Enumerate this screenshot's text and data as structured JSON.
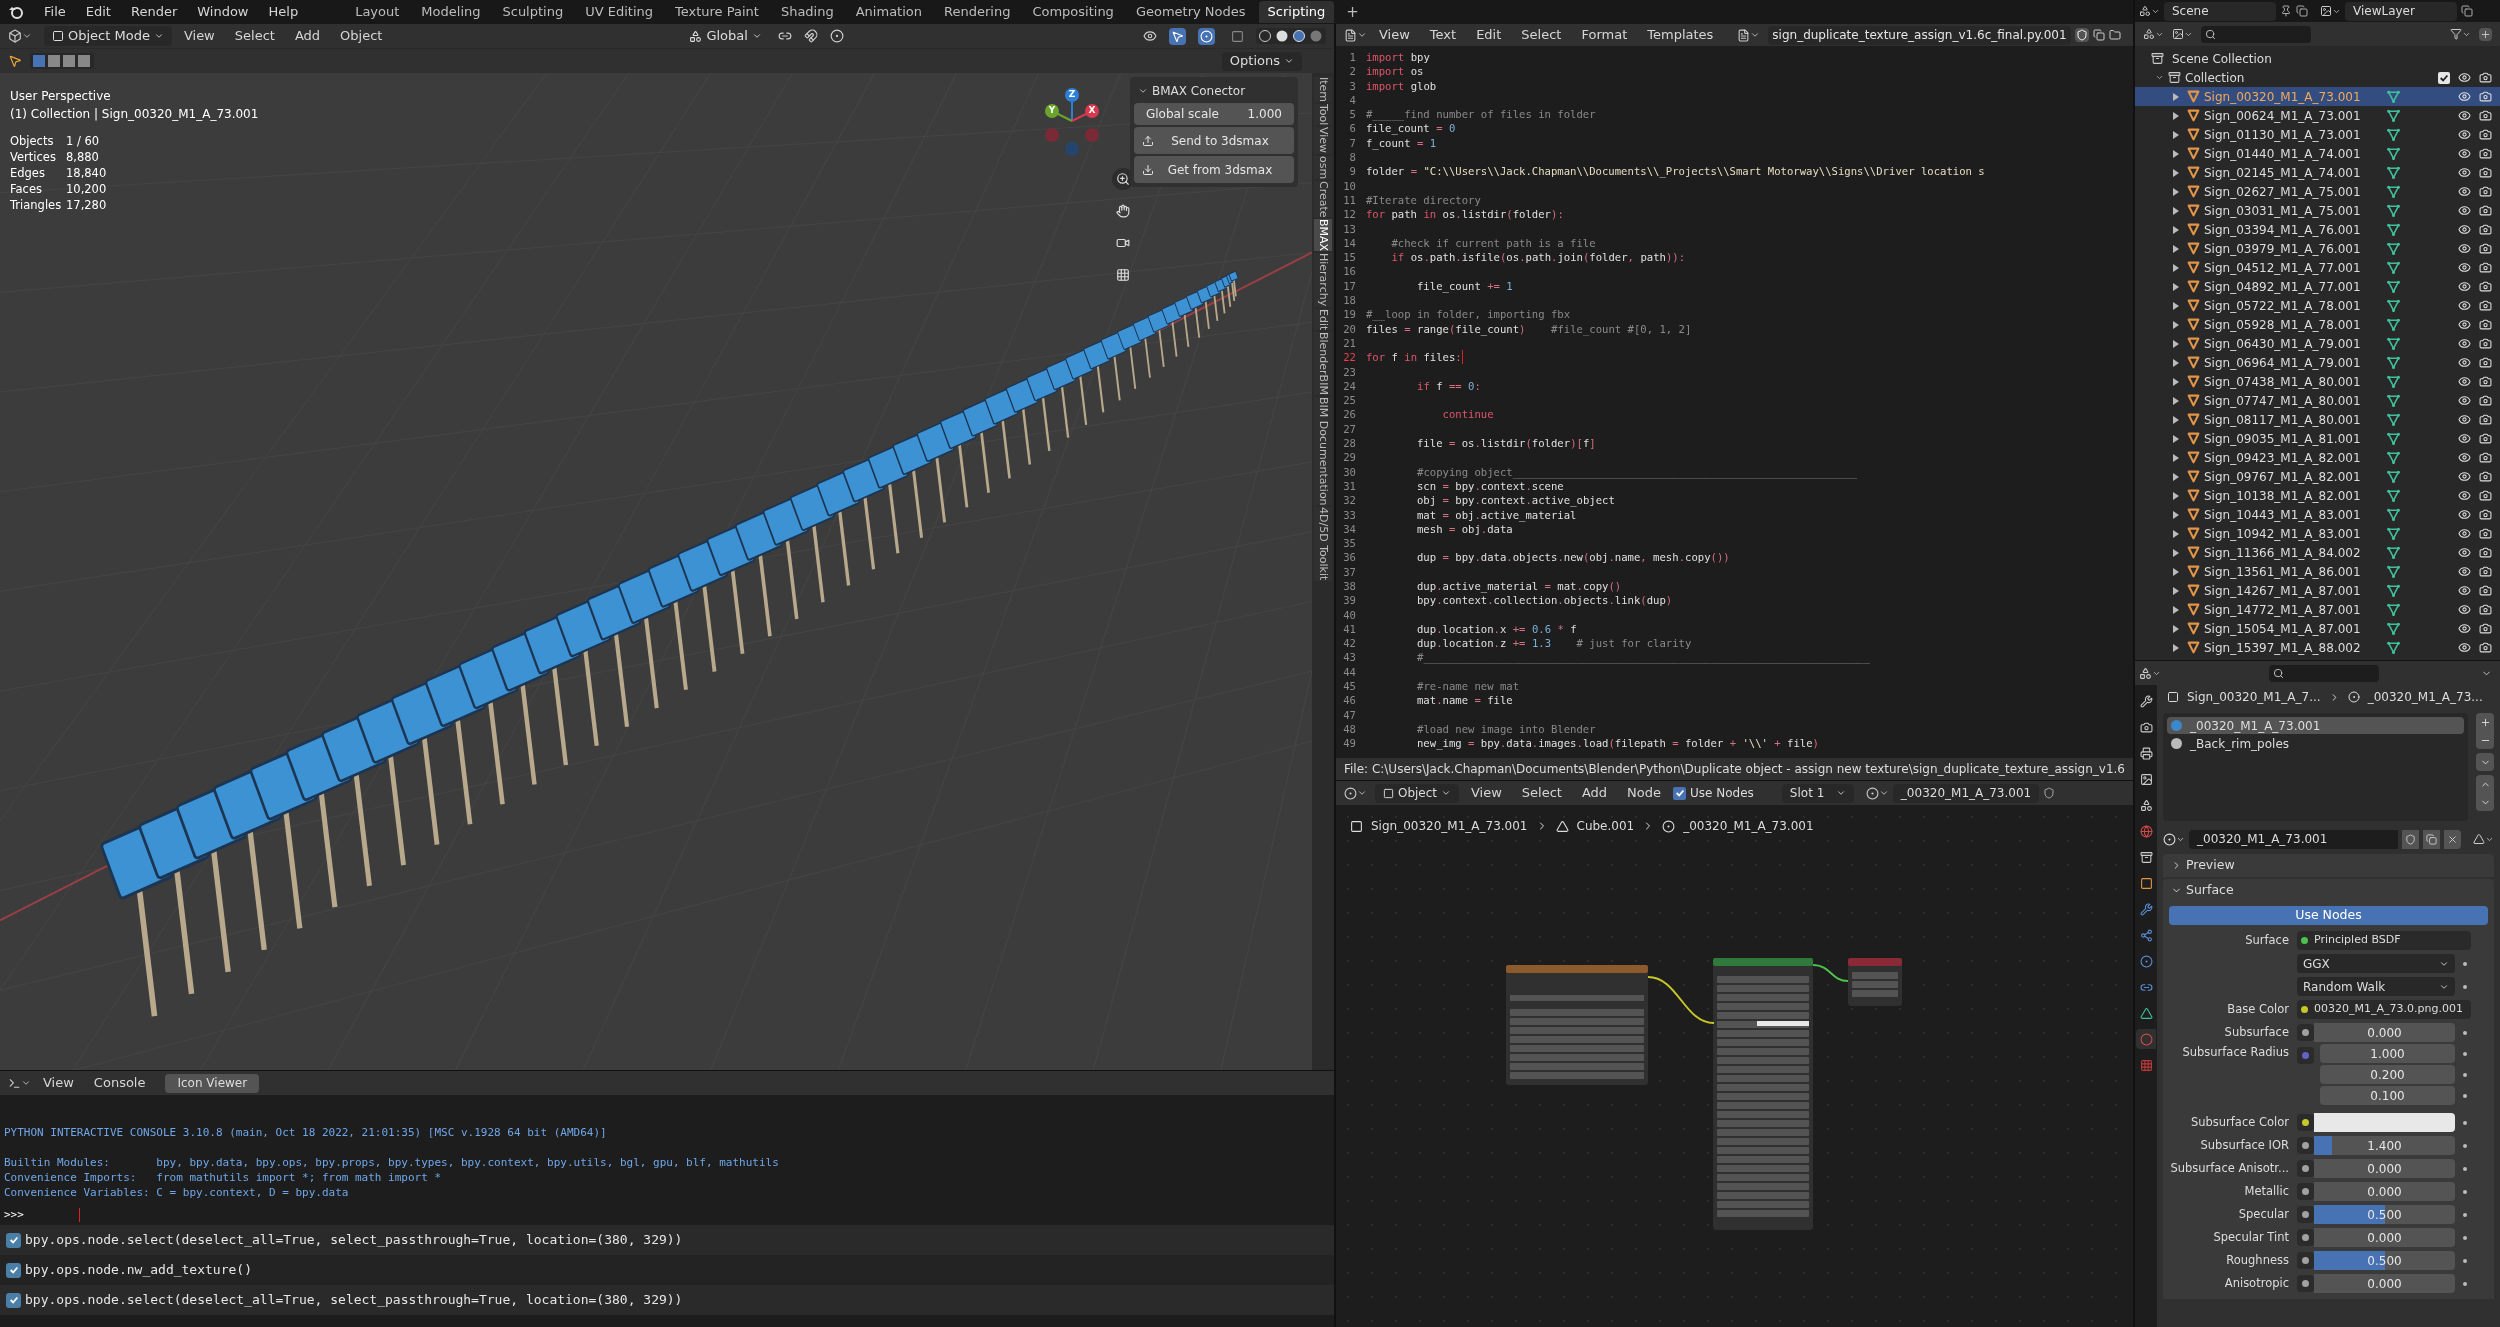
{
  "top_bar": {
    "menus": [
      "File",
      "Edit",
      "Render",
      "Window",
      "Help"
    ],
    "workspaces": [
      {
        "label": "Layout",
        "selected": false
      },
      {
        "label": "Modeling",
        "selected": false
      },
      {
        "label": "Sculpting",
        "selected": false
      },
      {
        "label": "UV Editing",
        "selected": false
      },
      {
        "label": "Texture Paint",
        "selected": false
      },
      {
        "label": "Shading",
        "selected": false
      },
      {
        "label": "Animation",
        "selected": false
      },
      {
        "label": "Rendering",
        "selected": false
      },
      {
        "label": "Compositing",
        "selected": false
      },
      {
        "label": "Geometry Nodes",
        "selected": false
      },
      {
        "label": "Scripting",
        "selected": true
      }
    ],
    "add_workspace": "+"
  },
  "viewport": {
    "mode": "Object Mode",
    "menus": [
      "View",
      "Select",
      "Add",
      "Object"
    ],
    "orientation": "Global",
    "options": "Options",
    "view_name": "User Perspective",
    "collection_line": "(1) Collection | Sign_00320_M1_A_73.001",
    "stats": [
      {
        "label": "Objects",
        "value": "1 / 60"
      },
      {
        "label": "Vertices",
        "value": "8,880"
      },
      {
        "label": "Edges",
        "value": "18,840"
      },
      {
        "label": "Faces",
        "value": "10,200"
      },
      {
        "label": "Triangles",
        "value": "17,280"
      }
    ],
    "gizmo_axes": [
      {
        "label": "Z",
        "color": "#2e80d6"
      },
      {
        "label": "Y",
        "color": "#6aa42c"
      },
      {
        "label": "X",
        "color": "#d7394f"
      }
    ],
    "bmax_panel": {
      "title": "BMAX Conector",
      "scale_label": "Global scale",
      "scale_value": "1.000",
      "buttons": [
        {
          "kind": "upload",
          "label": "Send to 3dsmax"
        },
        {
          "kind": "download",
          "label": "Get from 3dsmax"
        }
      ]
    },
    "side_tabs": [
      {
        "label": "Item",
        "selected": false
      },
      {
        "label": "Tool",
        "selected": false
      },
      {
        "label": "View",
        "selected": false
      },
      {
        "label": "osm",
        "selected": false
      },
      {
        "label": "Create",
        "selected": false
      },
      {
        "label": "BMAX",
        "selected": true
      },
      {
        "label": "Hierarchy",
        "selected": false
      },
      {
        "label": "Edit",
        "selected": false
      },
      {
        "label": "BlenderBIM",
        "selected": false
      },
      {
        "label": "BIM Documentation",
        "selected": false
      },
      {
        "label": "4D/5D Toolkit",
        "selected": false
      }
    ]
  },
  "console": {
    "menus": [
      "View",
      "Console"
    ],
    "icon_viewer": "Icon Viewer",
    "output": [
      "PYTHON INTERACTIVE CONSOLE 3.10.8 (main, Oct 18 2022, 21:01:35) [MSC v.1928 64 bit (AMD64)]",
      "Builtin Modules:       bpy, bpy.data, bpy.ops, bpy.props, bpy.types, bpy.context, bpy.utils, bgl, gpu, blf, mathutils",
      "Convenience Imports:   from mathutils import *; from math import *",
      "Convenience Variables: C = bpy.context, D = bpy.data"
    ],
    "prompt": ">>>",
    "reports": [
      {
        "text": "bpy.ops.node.select(deselect_all=True, select_passthrough=True, location=(380, 329))",
        "checked": true
      },
      {
        "text": "bpy.ops.node.nw_add_texture()",
        "checked": true
      },
      {
        "text": "bpy.ops.node.select(deselect_all=True, select_passthrough=True, location=(380, 329))",
        "checked": true
      }
    ]
  },
  "text_editor": {
    "menus": [
      "View",
      "Text",
      "Edit",
      "Select",
      "Format",
      "Templates"
    ],
    "file_name": "sign_duplicate_texture_assign_v1.6c_final.py.001",
    "lines": [
      {
        "number": "1",
        "code": "import bpy",
        "current": false
      },
      {
        "number": "2",
        "code": "import os",
        "current": false
      },
      {
        "number": "3",
        "code": "import glob",
        "current": false
      },
      {
        "number": "4",
        "current": false
      },
      {
        "number": "5",
        "code": "#_____find number of files in folder",
        "current": false
      },
      {
        "number": "6",
        "code": "file_count = 0",
        "current": false
      },
      {
        "number": "7",
        "code": "f_count = 1",
        "current": false
      },
      {
        "number": "8",
        "current": false
      },
      {
        "number": "9",
        "code": "folder = \"C:\\\\Users\\\\Jack.Chapman\\\\Documents\\\\_Projects\\\\Smart Motorway\\\\Signs\\\\Driver location s",
        "current": false
      },
      {
        "number": "10",
        "current": false
      },
      {
        "number": "11",
        "code": "#Iterate directory",
        "current": false
      },
      {
        "number": "12",
        "code": "for path in os.listdir(folder):",
        "current": false
      },
      {
        "number": "13",
        "current": false
      },
      {
        "number": "14",
        "code": "    #check if current path is a file",
        "current": false
      },
      {
        "number": "15",
        "code": "    if os.path.isfile(os.path.join(folder, path)):",
        "current": false
      },
      {
        "number": "16",
        "current": false
      },
      {
        "number": "17",
        "code": "        file_count += 1",
        "current": false
      },
      {
        "number": "18",
        "current": false
      },
      {
        "number": "19",
        "code": "#__loop in folder, importing fbx",
        "current": false
      },
      {
        "number": "20",
        "code": "files = range(file_count)    #file_count #[0, 1, 2]",
        "current": false
      },
      {
        "number": "21",
        "current": false
      },
      {
        "number": "22",
        "code": "for f in files:",
        "current": true
      },
      {
        "number": "23",
        "current": false
      },
      {
        "number": "24",
        "code": "        if f == 0:",
        "current": false
      },
      {
        "number": "25",
        "current": false
      },
      {
        "number": "26",
        "code": "            continue",
        "current": false
      },
      {
        "number": "27",
        "current": false
      },
      {
        "number": "28",
        "code": "        file = os.listdir(folder)[f]",
        "current": false
      },
      {
        "number": "29",
        "current": false
      },
      {
        "number": "30",
        "code": "        #copying object______________________________________________________",
        "current": false
      },
      {
        "number": "31",
        "code": "        scn = bpy.context.scene",
        "current": false
      },
      {
        "number": "32",
        "code": "        obj = bpy.context.active_object",
        "current": false
      },
      {
        "number": "33",
        "code": "        mat = obj.active_material",
        "current": false
      },
      {
        "number": "34",
        "code": "        mesh = obj.data",
        "current": false
      },
      {
        "number": "35",
        "current": false
      },
      {
        "number": "36",
        "code": "        dup = bpy.data.objects.new(obj.name, mesh.copy())",
        "current": false
      },
      {
        "number": "37",
        "current": false
      },
      {
        "number": "38",
        "code": "        dup.active_material = mat.copy()",
        "current": false
      },
      {
        "number": "39",
        "code": "        bpy.context.collection.objects.link(dup)",
        "current": false
      },
      {
        "number": "40",
        "current": false
      },
      {
        "number": "41",
        "code": "        dup.location.x += 0.6 * f",
        "current": false
      },
      {
        "number": "42",
        "code": "        dup.location.z += 1.3    # just for clarity",
        "current": false
      },
      {
        "number": "43",
        "code": "        #______________________________________________________________________",
        "current": false
      },
      {
        "number": "44",
        "current": false
      },
      {
        "number": "45",
        "code": "        #re-name new mat",
        "current": false
      },
      {
        "number": "46",
        "code": "        mat.name = file",
        "current": false
      },
      {
        "number": "47",
        "current": false
      },
      {
        "number": "48",
        "code": "        #load new image into Blender",
        "current": false
      },
      {
        "number": "49",
        "code": "        new_img = bpy.data.images.load(filepath = folder + '\\\\' + file)",
        "current": false
      }
    ],
    "footer": "File: C:\\Users\\Jack.Chapman\\Documents\\Blender\\Python\\Duplicate object - assign new texture\\sign_duplicate_texture_assign_v1.6"
  },
  "node_editor": {
    "object_menu": "Object",
    "menus": [
      "View",
      "Select",
      "Add",
      "Node"
    ],
    "use_nodes": {
      "label": "Use Nodes",
      "checked": true
    },
    "slot": "Slot 1",
    "material": "_00320_M1_A_73.001",
    "breadcrumb": [
      {
        "kind": "object",
        "label": "Sign_00320_M1_A_73.001"
      },
      {
        "kind": "mesh",
        "label": "Cube.001"
      },
      {
        "kind": "material",
        "label": "_00320_M1_A_73.001"
      }
    ]
  },
  "outliner": {
    "scene": "Scene",
    "view_layer": "ViewLayer",
    "root": "Scene Collection",
    "collection": {
      "label": "Collection",
      "expanded": true,
      "checked": true,
      "children": [
        {
          "label": "Sign_00320_M1_A_73.001",
          "selected": true
        },
        {
          "label": "Sign_00624_M1_A_73.001",
          "selected": false
        },
        {
          "label": "Sign_01130_M1_A_73.001",
          "selected": false
        },
        {
          "label": "Sign_01440_M1_A_74.001",
          "selected": false
        },
        {
          "label": "Sign_02145_M1_A_74.001",
          "selected": false
        },
        {
          "label": "Sign_02627_M1_A_75.001",
          "selected": false
        },
        {
          "label": "Sign_03031_M1_A_75.001",
          "selected": false
        },
        {
          "label": "Sign_03394_M1_A_76.001",
          "selected": false
        },
        {
          "label": "Sign_03979_M1_A_76.001",
          "selected": false
        },
        {
          "label": "Sign_04512_M1_A_77.001",
          "selected": false
        },
        {
          "label": "Sign_04892_M1_A_77.001",
          "selected": false
        },
        {
          "label": "Sign_05722_M1_A_78.001",
          "selected": false
        },
        {
          "label": "Sign_05928_M1_A_78.001",
          "selected": false
        },
        {
          "label": "Sign_06430_M1_A_79.001",
          "selected": false
        },
        {
          "label": "Sign_06964_M1_A_79.001",
          "selected": false
        },
        {
          "label": "Sign_07438_M1_A_80.001",
          "selected": false
        },
        {
          "label": "Sign_07747_M1_A_80.001",
          "selected": false
        },
        {
          "label": "Sign_08117_M1_A_80.001",
          "selected": false
        },
        {
          "label": "Sign_09035_M1_A_81.001",
          "selected": false
        },
        {
          "label": "Sign_09423_M1_A_82.001",
          "selected": false
        },
        {
          "label": "Sign_09767_M1_A_82.001",
          "selected": false
        },
        {
          "label": "Sign_10138_M1_A_82.001",
          "selected": false
        },
        {
          "label": "Sign_10443_M1_A_83.001",
          "selected": false
        },
        {
          "label": "Sign_10942_M1_A_83.001",
          "selected": false
        },
        {
          "label": "Sign_11366_M1_A_84.002",
          "selected": false
        },
        {
          "label": "Sign_13561_M1_A_86.001",
          "selected": false
        },
        {
          "label": "Sign_14267_M1_A_87.001",
          "selected": false
        },
        {
          "label": "Sign_14772_M1_A_87.001",
          "selected": false
        },
        {
          "label": "Sign_15054_M1_A_87.001",
          "selected": false
        },
        {
          "label": "Sign_15397_M1_A_88.002",
          "selected": false
        }
      ]
    }
  },
  "properties": {
    "tabs": [
      {
        "kind": "tool",
        "selected": false
      },
      {
        "kind": "render",
        "selected": false
      },
      {
        "kind": "output",
        "selected": false
      },
      {
        "kind": "view_layer",
        "selected": false
      },
      {
        "kind": "scene",
        "selected": false
      },
      {
        "kind": "world",
        "selected": false
      },
      {
        "kind": "collection",
        "selected": false
      },
      {
        "kind": "object",
        "selected": false
      },
      {
        "kind": "modifier",
        "selected": false
      },
      {
        "kind": "particles",
        "selected": false
      },
      {
        "kind": "physics",
        "selected": false
      },
      {
        "kind": "constraints",
        "selected": false
      },
      {
        "kind": "data",
        "selected": false
      },
      {
        "kind": "material",
        "selected": true
      },
      {
        "kind": "texture",
        "selected": false
      }
    ],
    "breadcrumb": [
      "Sign_00320_M1_A_7...",
      "_00320_M1_A_73..."
    ],
    "slots": [
      {
        "label": "_00320_M1_A_73.001",
        "selected": true
      },
      {
        "label": "_Back_rim_poles",
        "selected": false
      }
    ],
    "material_name": "_00320_M1_A_73.001",
    "panels": [
      {
        "title": "Preview",
        "expanded": false
      },
      {
        "title": "Surface",
        "expanded": true
      }
    ],
    "use_nodes": "Use Nodes",
    "rows": [
      {
        "kind": "link",
        "label": "Surface",
        "value": "Principled BSDF",
        "color": "#4dc24d"
      },
      {
        "kind": "dropdown",
        "value": "GGX"
      },
      {
        "kind": "dropdown",
        "value": "Random Walk"
      },
      {
        "kind": "link",
        "label": "Base Color",
        "value": "00320_M1_A_73.0.png.001",
        "color": "#c7c729"
      },
      {
        "kind": "number",
        "label": "Subsurface",
        "value": "0.000",
        "color": "#a1a1a1"
      },
      {
        "kind": "vector",
        "label": "Subsurface Radius",
        "values": [
          "1.000",
          "0.200",
          "0.100"
        ],
        "color": "#6363c7"
      },
      {
        "kind": "swatch",
        "label": "Subsurface Color",
        "color": "#c7c729"
      },
      {
        "kind": "number",
        "label": "Subsurface IOR",
        "value": "1.400",
        "level": 0.13,
        "color": "#a1a1a1"
      },
      {
        "kind": "number",
        "label": "Subsurface Anisotr...",
        "value": "0.000",
        "color": "#a1a1a1"
      },
      {
        "kind": "number",
        "label": "Metallic",
        "value": "0.000",
        "color": "#a1a1a1"
      },
      {
        "kind": "number",
        "label": "Specular",
        "value": "0.500",
        "level": 0.5,
        "color": "#a1a1a1"
      },
      {
        "kind": "number",
        "label": "Specular Tint",
        "value": "0.000",
        "color": "#a1a1a1"
      },
      {
        "kind": "number",
        "label": "Roughness",
        "value": "0.500",
        "level": 0.5,
        "color": "#a1a1a1"
      },
      {
        "kind": "number",
        "label": "Anisotropic",
        "value": "0.000",
        "color": "#a1a1a1"
      }
    ]
  }
}
